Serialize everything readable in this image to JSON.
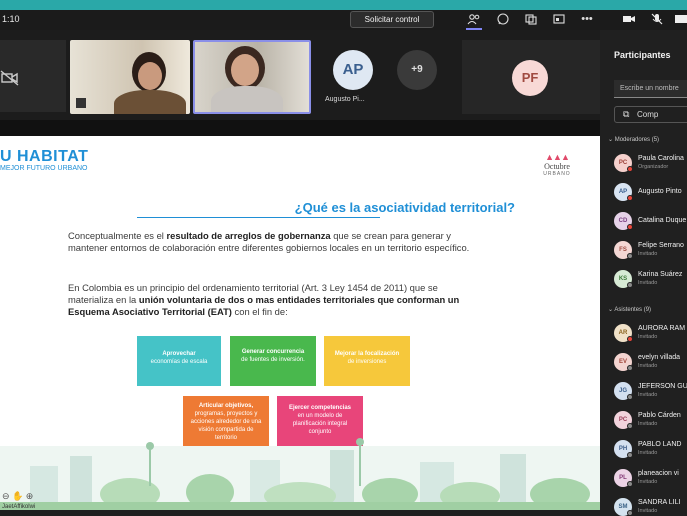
{
  "meeting": {
    "time": "1:10",
    "request_control_label": "Solicitar control",
    "toolbar_icons": [
      "people-icon",
      "chat-icon",
      "reactions-icon",
      "share-tray-icon",
      "more-icon",
      "camera-icon",
      "mic-icon",
      "share-icon"
    ]
  },
  "videos": {
    "overflow_count": "+9",
    "avatar_ap": {
      "initials": "AP",
      "name": "Augusto Pi..."
    },
    "avatar_pf": {
      "initials": "PF"
    }
  },
  "slide": {
    "logo_text": "U HABITAT",
    "logo_sub": "MEJOR FUTURO URBANO",
    "partner_logo": {
      "dots": "▲▲▲",
      "name": "Octubre",
      "sub": "URBANO"
    },
    "title": "¿Qué es la asociatividad territorial?",
    "para1": {
      "t1": "Conceptualmente es el ",
      "b1": "resultado de arreglos de gobernanza",
      "t2": " que se crean para generar y mantener entornos de colaboración entre diferentes gobiernos locales en un territorio específico."
    },
    "para2": {
      "t1": "En Colombia es un principio del ordenamiento territorial (Art. 3 Ley 1454 de 2011) que se materializa en la ",
      "b1": "unión voluntaria de dos o mas entidades territoriales que conforman un Esquema Asociativo Territorial (EAT)",
      "t2": " con el fin de:"
    },
    "boxes": [
      {
        "bold": "Aprovechar",
        "text": "economías de escala"
      },
      {
        "bold": "Generar concurrencia",
        "text": "de fuentes de inversión."
      },
      {
        "bold": "Mejorar la focalización",
        "text": "de inversiones"
      },
      {
        "bold": "Articular objetivos,",
        "text": "programas, proyectos y acciones alrededor de una visión compartida de territorio"
      },
      {
        "bold": "Ejercer competencias",
        "text": "en un modelo de planificación integral conjunto"
      }
    ],
    "presenter": "JaetAffikolwi"
  },
  "panel": {
    "title": "Participantes",
    "search_placeholder": "Escribe un nombre",
    "share_button": "Comp",
    "moderators_header": "Moderadores (5)",
    "attendees_header": "Asistentes (9)",
    "moderators": [
      {
        "initials": "PC",
        "name": "Paula Carolina",
        "role": "Organizador",
        "color": "#f5d0cc",
        "text_color": "#9c4138",
        "dot": "#e8463a"
      },
      {
        "initials": "AP",
        "name": "Augusto Pinto",
        "role": "",
        "color": "#d8e4f2",
        "text_color": "#375c8c",
        "dot": "#e8463a"
      },
      {
        "initials": "CD",
        "name": "Catalina Duque",
        "role": "",
        "color": "#e6d2e8",
        "text_color": "#7a3f80",
        "dot": "#e8463a"
      },
      {
        "initials": "FS",
        "name": "Felipe Serrano",
        "role": "Invitado",
        "color": "#f4d7d4",
        "text_color": "#9e4a40",
        "dot": "#8a8a8a"
      },
      {
        "initials": "KS",
        "name": "Karina Suárez",
        "role": "Invitado",
        "color": "#d7ead5",
        "text_color": "#3d7a3a",
        "dot": "#8a8a8a"
      }
    ],
    "attendees": [
      {
        "initials": "AR",
        "name": "AURORA RAM",
        "role": "Invitado",
        "color": "#f0e1c8",
        "text_color": "#8a6420",
        "dot": "#e8463a"
      },
      {
        "initials": "EV",
        "name": "evelyn villada",
        "role": "Invitado",
        "color": "#f4d4d0",
        "text_color": "#a04438",
        "dot": "#8a8a8a"
      },
      {
        "initials": "JG",
        "name": "JEFERSON GU",
        "role": "Invitado",
        "color": "#d3e0f0",
        "text_color": "#3a5d8a",
        "dot": "#8a8a8a"
      },
      {
        "initials": "PC",
        "name": "Pablo Cárden",
        "role": "Invitado",
        "color": "#f2d3dc",
        "text_color": "#9a3d58",
        "dot": "#8a8a8a"
      },
      {
        "initials": "PH",
        "name": "PABLO LAND",
        "role": "Invitado",
        "color": "#d4e0f0",
        "text_color": "#3b5c88",
        "dot": "#8a8a8a"
      },
      {
        "initials": "PL",
        "name": "planeacion vi",
        "role": "Invitado",
        "color": "#ecd3e6",
        "text_color": "#843b78",
        "dot": "#8a8a8a"
      },
      {
        "initials": "SM",
        "name": "SANDRA LILI",
        "role": "Invitado",
        "color": "#d4e3ef",
        "text_color": "#3a6286",
        "dot": "#8a8a8a"
      }
    ]
  }
}
